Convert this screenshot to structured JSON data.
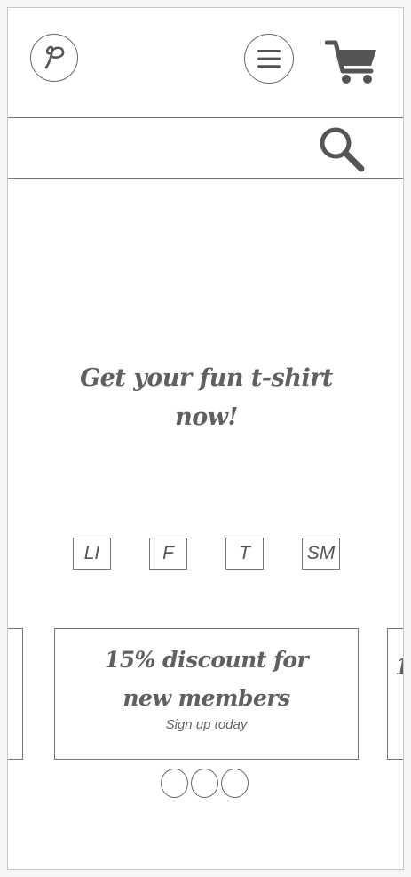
{
  "header": {
    "logo_icon": "script-p-logo-icon",
    "menu_icon": "hamburger-menu-icon",
    "cart_icon": "shopping-cart-icon"
  },
  "search": {
    "value": "",
    "placeholder": "",
    "icon": "magnifier-search-icon"
  },
  "hero": {
    "line1": "Get your fun t-shirt",
    "line2": "now!"
  },
  "socials": [
    {
      "label": "LI"
    },
    {
      "label": "F"
    },
    {
      "label": "T"
    },
    {
      "label": "SM"
    }
  ],
  "carousel": {
    "active": {
      "title_line1": "15% discount for",
      "title_line2": "new members",
      "subtitle": "Sign up today"
    },
    "next_peek": "1",
    "dots_count": 3
  },
  "colors": {
    "stroke": "#666666",
    "text": "#606060",
    "background": "#ffffff"
  }
}
